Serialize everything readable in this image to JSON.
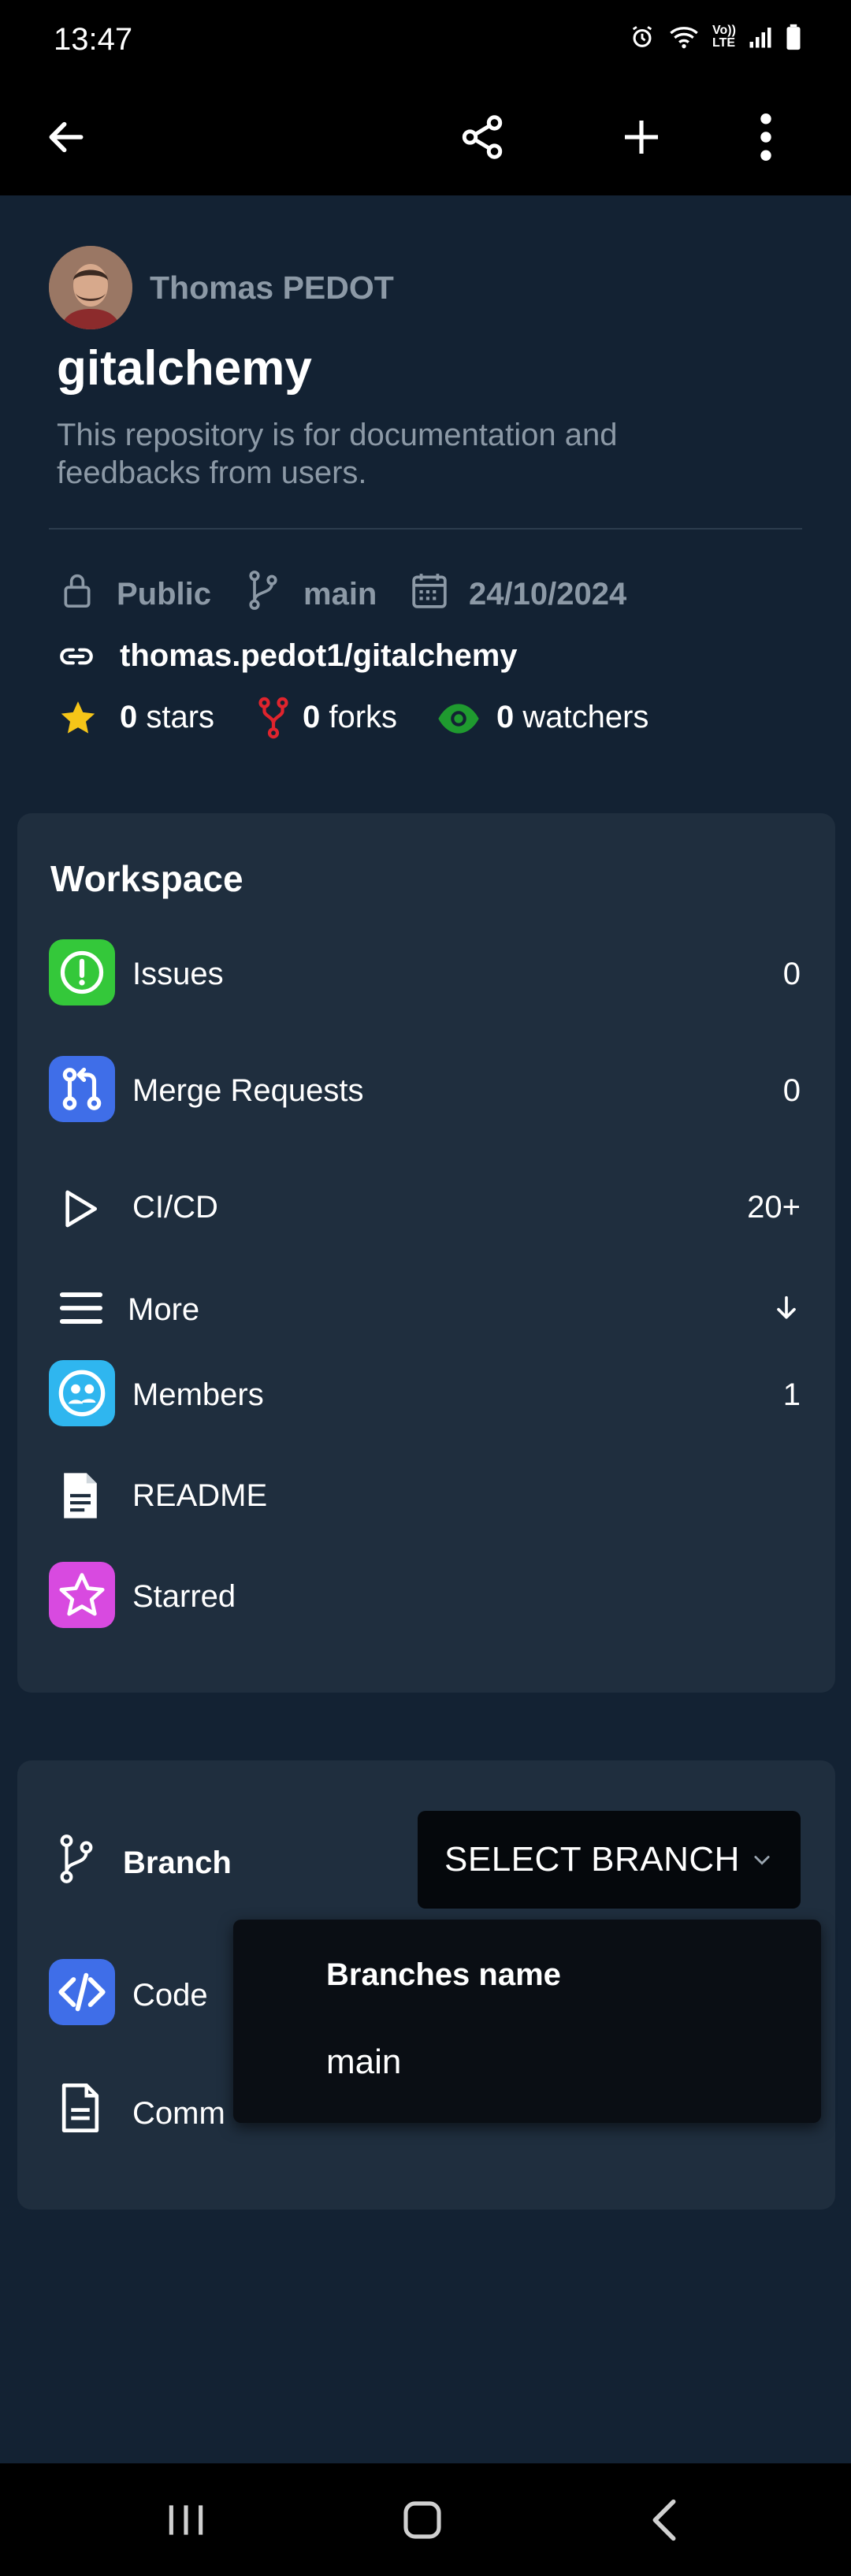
{
  "status_bar": {
    "time": "13:47",
    "icons": [
      "alarm-icon",
      "wifi-icon",
      "volte-icon",
      "signal-icon",
      "battery-icon"
    ],
    "volte_text": "Vo)) LTE"
  },
  "app_bar": {
    "icons": [
      "back-arrow-icon",
      "share-icon",
      "add-icon",
      "more-vert-icon"
    ]
  },
  "repo": {
    "owner": "Thomas PEDOT",
    "name": "gitalchemy",
    "description": "This repository is for documentation and feedbacks from users.",
    "visibility": "Public",
    "default_branch": "main",
    "date": "24/10/2024",
    "path": "thomas.pedot1/gitalchemy",
    "stars": "0",
    "stars_label": "stars",
    "forks": "0",
    "forks_label": "forks",
    "watchers": "0",
    "watchers_label": "watchers"
  },
  "workspace": {
    "title": "Workspace",
    "issues": {
      "label": "Issues",
      "count": "0"
    },
    "merge_requests": {
      "label": "Merge Requests",
      "count": "0"
    },
    "cicd": {
      "label": "CI/CD",
      "count": "20+"
    },
    "more": {
      "label": "More"
    },
    "members": {
      "label": "Members",
      "count": "1"
    },
    "readme": {
      "label": "README"
    },
    "starred": {
      "label": "Starred"
    }
  },
  "branch_section": {
    "branch_label": "Branch",
    "select_label": "SELECT BRANCH",
    "code_label": "Code",
    "commits_label": "Comm"
  },
  "dropdown": {
    "header": "Branches name",
    "options": [
      "main"
    ]
  },
  "colors": {
    "background": "#132233",
    "card": "#1f2e3e",
    "muted_text": "#8c99a6",
    "issues_icon": "#34c83a",
    "merge_icon": "#3f6ee8",
    "members_icon": "#2fb6ef",
    "starred_icon": "#d84ae0",
    "code_icon": "#3f6ee8",
    "star": "#f5c518",
    "fork": "#e0242d",
    "watch": "#1f9a2f"
  }
}
